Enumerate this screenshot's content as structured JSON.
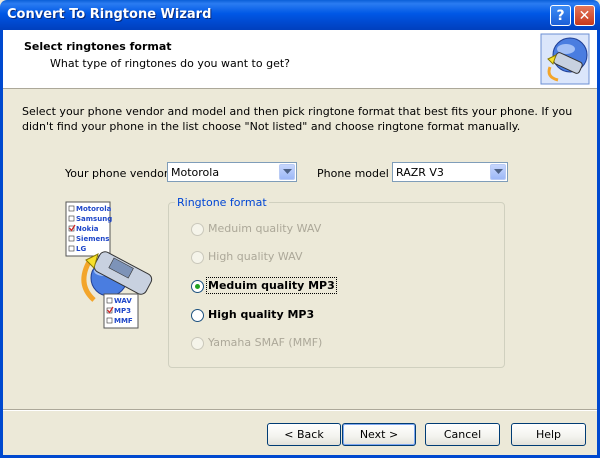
{
  "window": {
    "title": "Convert To Ringtone Wizard",
    "help_glyph": "?",
    "close_glyph": "✕"
  },
  "header": {
    "title": "Select ringtones format",
    "subtitle": "What type of ringtones do you want to get?",
    "icon": "phone-wizard-icon"
  },
  "description": "Select your phone vendor and model and then pick ringtone format that best fits your phone. If you didn't find your phone in the list choose \"Not listed\" and choose ringtone format manually.",
  "vendor": {
    "label": "Your phone vendor",
    "value": "Motorola"
  },
  "model": {
    "label": "Phone model",
    "value": "RAZR V3"
  },
  "format": {
    "legend": "Ringtone format",
    "options": [
      {
        "label": "Meduim quality WAV",
        "enabled": false,
        "checked": false
      },
      {
        "label": "High quality WAV",
        "enabled": false,
        "checked": false
      },
      {
        "label": "Meduim quality MP3",
        "enabled": true,
        "checked": true
      },
      {
        "label": "High quality MP3",
        "enabled": true,
        "checked": false
      },
      {
        "label": "Yamaha SMAF (MMF)",
        "enabled": false,
        "checked": false
      }
    ]
  },
  "illustration": {
    "vendors": [
      "Motorola",
      "Samsung",
      "Nokia",
      "Siemens",
      "LG"
    ],
    "formats": [
      "WAV",
      "MP3",
      "MMF"
    ]
  },
  "buttons": {
    "back": "< Back",
    "next": "Next >",
    "cancel": "Cancel",
    "help": "Help"
  },
  "colors": {
    "titlebar": "#0058e6",
    "face": "#ece9d8",
    "legend": "#0046d5",
    "radio_dot": "#21a121"
  }
}
